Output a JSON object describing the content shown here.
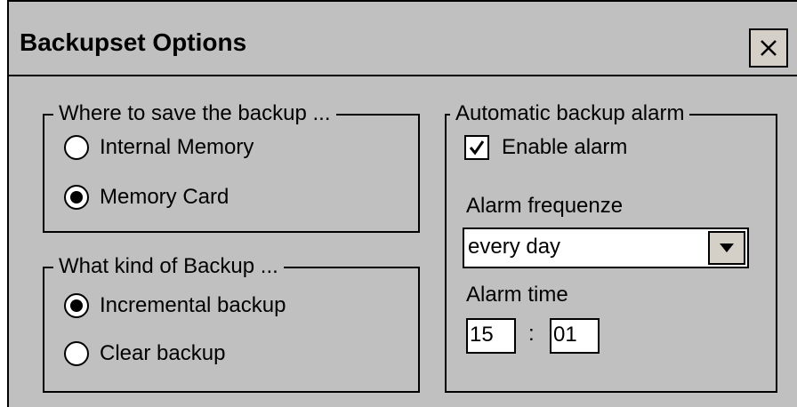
{
  "window": {
    "title": "Backupset Options",
    "close_icon": "close-icon"
  },
  "save_location": {
    "legend": "Where to save the backup ...",
    "options": [
      {
        "label": "Internal Memory",
        "checked": false
      },
      {
        "label": "Memory Card",
        "checked": true
      }
    ]
  },
  "backup_kind": {
    "legend": "What kind of Backup ...",
    "options": [
      {
        "label": "Incremental backup",
        "checked": true
      },
      {
        "label": "Clear backup",
        "checked": false
      }
    ]
  },
  "alarm": {
    "legend": "Automatic backup alarm",
    "enable_label": "Enable alarm",
    "enable_checked": true,
    "frequency_label": "Alarm frequenze",
    "frequency_value": "every day",
    "time_label": "Alarm time",
    "time_hour": "15",
    "time_separator": ":",
    "time_minute": "01"
  }
}
